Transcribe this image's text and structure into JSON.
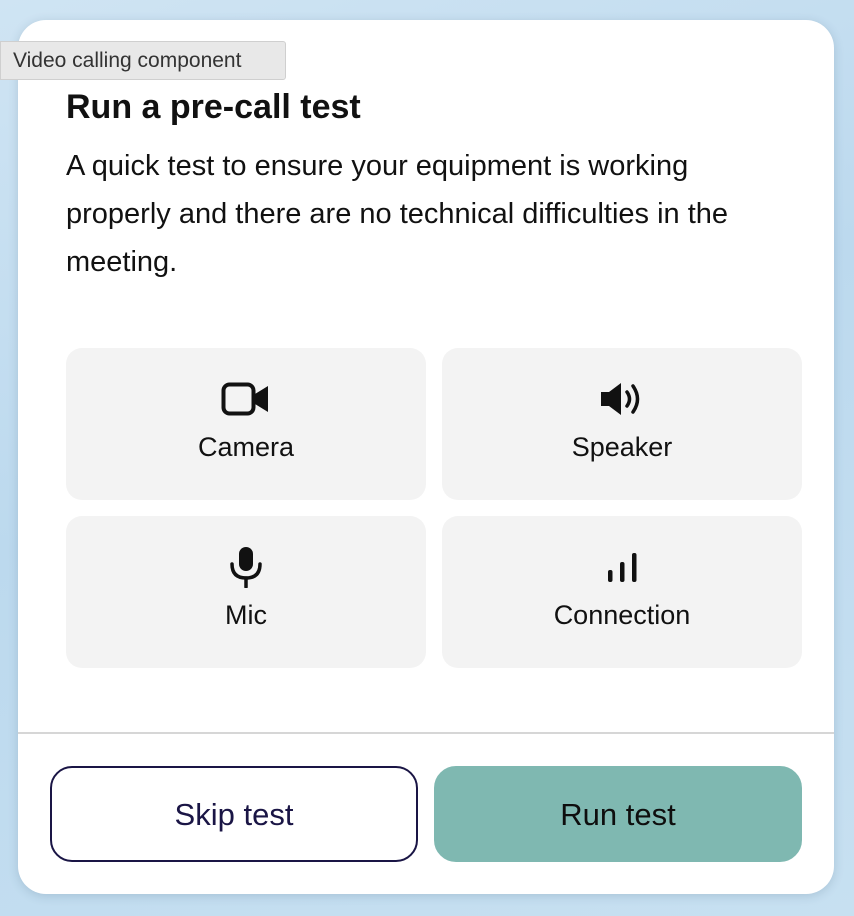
{
  "tooltip": {
    "text": "Video calling component"
  },
  "dialog": {
    "title": "Run a pre-call test",
    "description": "A quick test to ensure your equipment is working properly and there are no technical difficulties in the meeting."
  },
  "tests": [
    {
      "label": "Camera",
      "icon": "camera-icon"
    },
    {
      "label": "Speaker",
      "icon": "speaker-icon"
    },
    {
      "label": "Mic",
      "icon": "mic-icon"
    },
    {
      "label": "Connection",
      "icon": "signal-bars-icon"
    }
  ],
  "actions": {
    "skip_label": "Skip test",
    "run_label": "Run test"
  },
  "colors": {
    "primary_button": "#7fb8b1",
    "secondary_button_border": "#1a1545",
    "tile_background": "#f3f3f3"
  }
}
